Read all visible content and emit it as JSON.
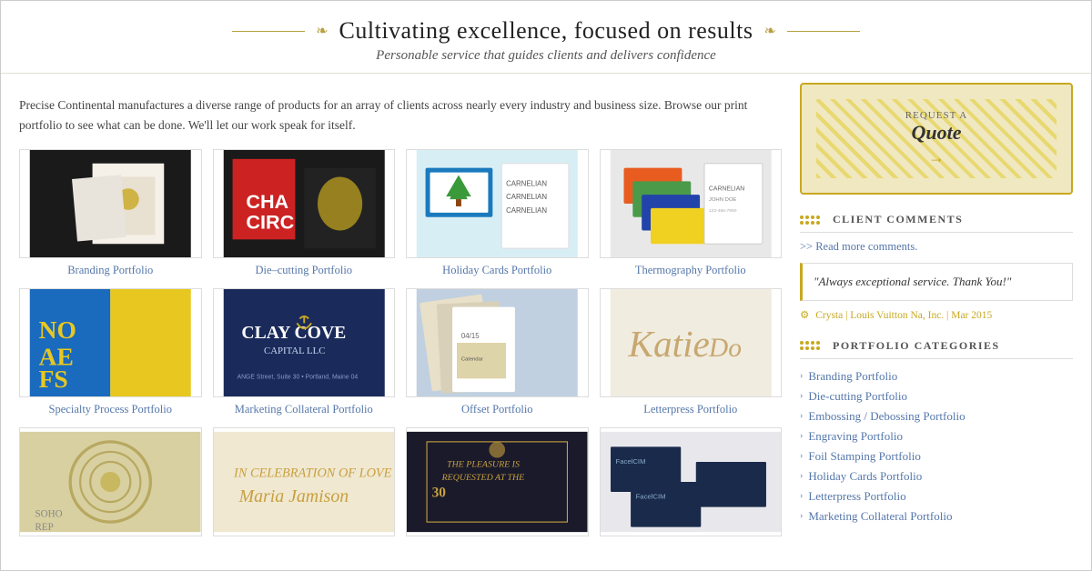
{
  "header": {
    "ornament_left": "❧",
    "ornament_right": "❧",
    "title": "Cultivating excellence, focused on results",
    "subtitle": "Personable service that guides clients and delivers confidence"
  },
  "intro": {
    "text": "Precise Continental manufactures a diverse range of products for an array of clients across nearly every industry and business size. Browse our print portfolio to see what can be done. We'll let our work speak for itself."
  },
  "portfolio_items": [
    {
      "id": "branding",
      "label": "Branding Portfolio",
      "thumb_class": "thumb-branding"
    },
    {
      "id": "diecutting",
      "label": "Die–cutting Portfolio",
      "thumb_class": "thumb-diecutting"
    },
    {
      "id": "holidaycards",
      "label": "Holiday Cards Portfolio",
      "thumb_class": "thumb-holidaycards"
    },
    {
      "id": "thermography",
      "label": "Thermography Portfolio",
      "thumb_class": "thumb-thermography"
    },
    {
      "id": "specialty",
      "label": "Specialty Process Portfolio",
      "thumb_class": "thumb-specialty"
    },
    {
      "id": "marketing",
      "label": "Marketing Collateral Portfolio",
      "thumb_class": "thumb-marketing"
    },
    {
      "id": "offset",
      "label": "Offset Portfolio",
      "thumb_class": "thumb-offset"
    },
    {
      "id": "letterpress",
      "label": "Letterpress Portfolio",
      "thumb_class": "thumb-letterpress"
    }
  ],
  "partial_items": [
    {
      "id": "engraving",
      "label": "",
      "thumb_class": "thumb-engraving"
    },
    {
      "id": "foil",
      "label": "",
      "thumb_class": "thumb-foil"
    },
    {
      "id": "holidaycards2",
      "label": "",
      "thumb_class": "thumb-holidaycards2"
    },
    {
      "id": "letterpress2",
      "label": "",
      "thumb_class": "thumb-letterpress2"
    }
  ],
  "sidebar": {
    "quote_box": {
      "request_small": "REQUEST a",
      "request_large": "Quote",
      "arrow": "→"
    },
    "comments_section": {
      "heading": "CLIENT COMMENTS",
      "read_more": ">> Read more comments.",
      "comment_text": "\"Always exceptional service. Thank You!\"",
      "attribution": "Crysta | Louis Vuitton Na, Inc. | Mar 2015"
    },
    "categories_section": {
      "heading": "PORTFOLIO CATEGORIES",
      "items": [
        "Branding Portfolio",
        "Die-cutting Portfolio",
        "Embossing / Debossing Portfolio",
        "Engraving Portfolio",
        "Foil Stamping Portfolio",
        "Holiday Cards Portfolio",
        "Letterpress Portfolio",
        "Marketing Collateral Portfolio"
      ]
    }
  }
}
